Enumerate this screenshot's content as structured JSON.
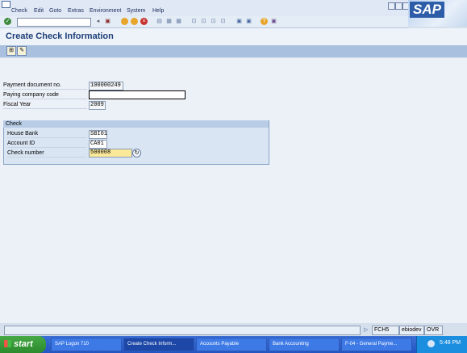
{
  "menu": [
    "Check",
    "Edit",
    "Goto",
    "Extras",
    "Environment",
    "System",
    "Help"
  ],
  "sap_logo": "SAP",
  "page_title": "Create Check Information",
  "form": {
    "payment_document_label": "Payment document no.",
    "payment_document_value": "100000249",
    "paying_company_label": "Paying company code",
    "paying_company_value": "",
    "fiscal_year_label": "Fiscal Year",
    "fiscal_year_value": "2009"
  },
  "check_group": {
    "title": "Check",
    "house_bank_label": "House Bank",
    "house_bank_value": "SBI01",
    "account_id_label": "Account ID",
    "account_id_value": "CA01",
    "check_number_label": "Check number",
    "check_number_value": "500008"
  },
  "status": {
    "transaction": "FCH5",
    "server": "ebiodev",
    "mode": "OVR"
  },
  "taskbar": {
    "start_label": "start",
    "items": [
      "SAP Logon 710",
      "Create Check Inform...",
      "Accounts Payable",
      "Bank Accounting",
      "F-04 - General Payme..."
    ],
    "clock": "5:48 PM"
  },
  "colors": {
    "header_bg": "#dfe8f4",
    "title_text": "#1e3f78",
    "group_bg": "#d9e5f3",
    "check_number_bg": "#fbe99a",
    "taskbar": "#2455c3"
  }
}
